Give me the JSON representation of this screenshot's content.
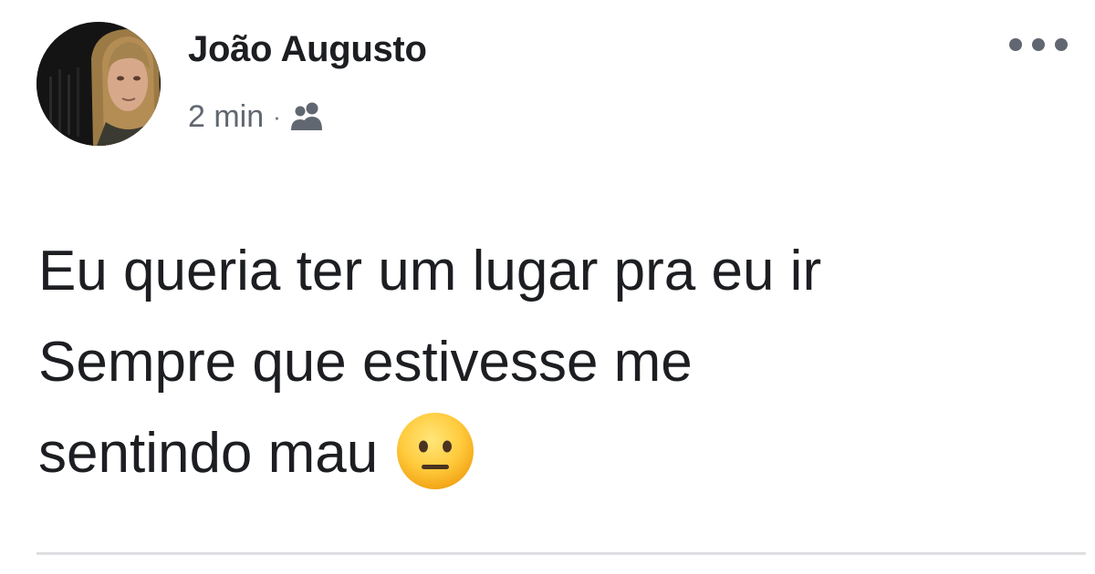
{
  "post": {
    "author": {
      "name": "João Augusto"
    },
    "meta": {
      "time": "2 min",
      "separator": "·",
      "audience_icon": "friends-icon"
    },
    "more_icon": "more-options-icon",
    "text_lines": [
      "Eu queria ter um lugar pra eu ir",
      "Sempre que estivesse me",
      "sentindo mau"
    ],
    "emoji": "neutral-face-emoji"
  },
  "colors": {
    "primary_text": "#1c1e21",
    "secondary_text": "#606770",
    "divider": "#dddfe2",
    "background": "#ffffff"
  }
}
